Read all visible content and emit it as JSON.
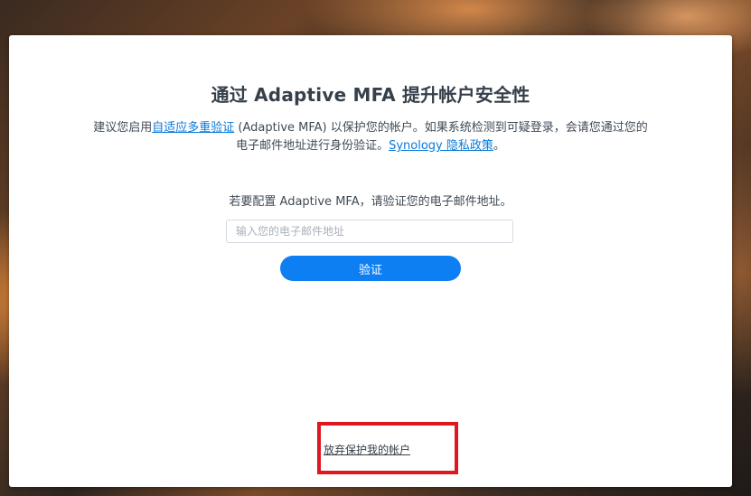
{
  "dialog": {
    "title": "通过 Adaptive MFA 提升帐户安全性",
    "description": {
      "part1": "建议您启用",
      "link_mfa": "自适应多重验证",
      "part2": " (Adaptive MFA) 以保护您的帐户。如果系统检测到可疑登录，会请您通过您的电子邮件地址进行身份验证。",
      "link_privacy": "Synology 隐私政策",
      "part3": "。"
    },
    "prompt": "若要配置 Adaptive MFA，请验证您的电子邮件地址。",
    "email_input": {
      "value": "",
      "placeholder": "输入您的电子邮件地址"
    },
    "verify_button": "验证",
    "give_up_link": "放弃保护我的帐户"
  },
  "colors": {
    "accent": "#0d7ff2",
    "link": "#0a7ad9",
    "highlight": "#e0171f",
    "title_text": "#36404b"
  }
}
